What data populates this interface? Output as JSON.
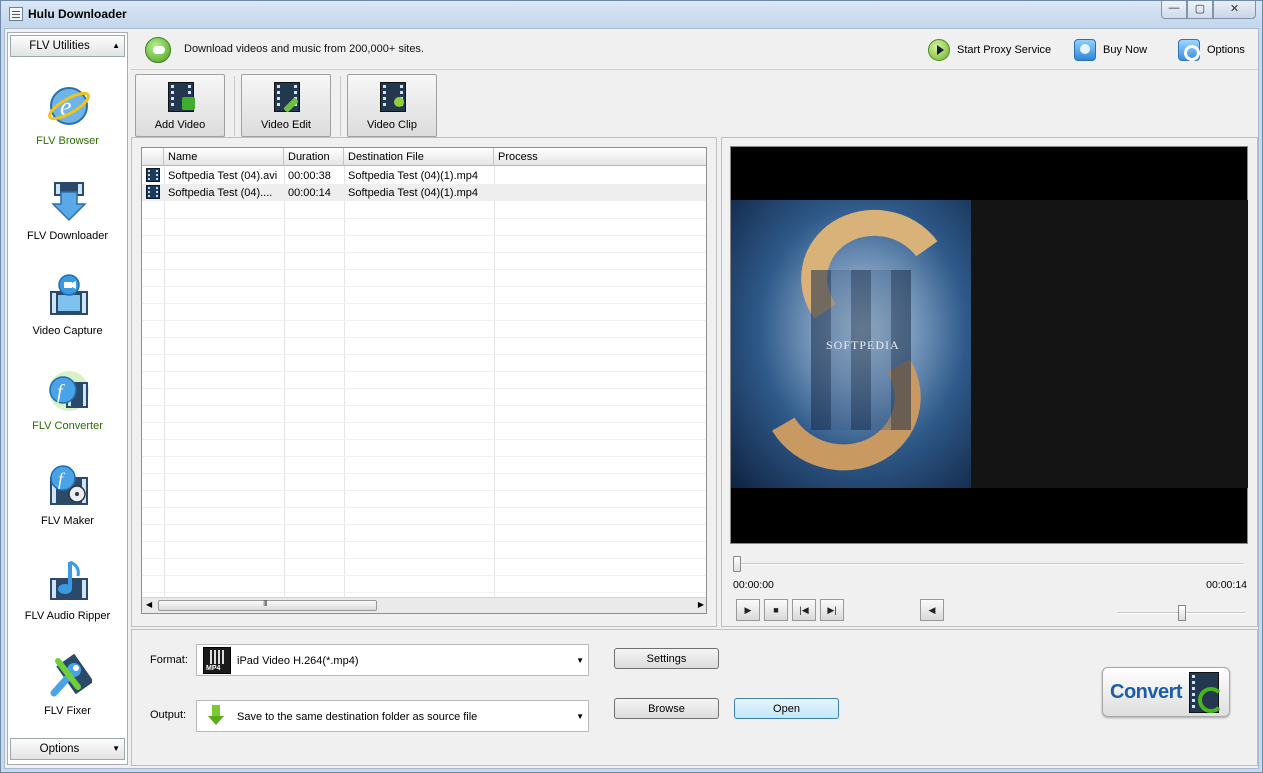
{
  "window": {
    "title": "Hulu Downloader",
    "minimize_glyph": "—",
    "maximize_glyph": "▢",
    "close_glyph": "✕"
  },
  "sidebar": {
    "header_label": "FLV Utilities",
    "footer_label": "Options",
    "items": [
      {
        "label": "FLV Browser",
        "icon": "globe-e-icon",
        "active": true
      },
      {
        "label": "FLV Downloader",
        "icon": "download-arrow-icon",
        "active": false
      },
      {
        "label": "Video Capture",
        "icon": "video-camera-icon",
        "active": false
      },
      {
        "label": "FLV Converter",
        "icon": "converter-f-icon",
        "active": true
      },
      {
        "label": "FLV Maker",
        "icon": "maker-f-film-icon",
        "active": false
      },
      {
        "label": "FLV Audio Ripper",
        "icon": "music-note-icon",
        "active": false
      },
      {
        "label": "FLV Fixer",
        "icon": "wrench-icon",
        "active": false
      }
    ]
  },
  "topbar": {
    "tagline": "Download videos and music from 200,000+ sites.",
    "links": [
      {
        "label": "Start Proxy Service",
        "icon": "play-circle-icon"
      },
      {
        "label": "Buy Now",
        "icon": "buy-icon"
      },
      {
        "label": "Options",
        "icon": "gears-icon"
      }
    ]
  },
  "toolbar": {
    "buttons": [
      {
        "label": "Add Video",
        "icon": "add-video-icon",
        "badge_color": "#3fae2a"
      },
      {
        "label": "Video Edit",
        "icon": "edit-video-icon",
        "badge_color": "#6bc23a"
      },
      {
        "label": "Video Clip",
        "icon": "clip-video-icon",
        "badge_color": "#8fcf3a"
      }
    ]
  },
  "file_list": {
    "columns": [
      "Name",
      "Duration",
      "Destination File",
      "Process"
    ],
    "rows": [
      {
        "name": "Softpedia Test (04).avi",
        "duration": "00:00:38",
        "destination": "Softpedia Test (04)(1).mp4",
        "process": ""
      },
      {
        "name": "Softpedia Test (04)....",
        "duration": "00:00:14",
        "destination": "Softpedia Test (04)(1).mp4",
        "process": ""
      }
    ],
    "scroll_grip": "III"
  },
  "preview": {
    "watermark": "SOFTPEDIA",
    "time_current": "00:00:00",
    "time_total": "00:00:14",
    "seek_position": 0,
    "volume_level": 0.5,
    "controls": [
      {
        "name": "play-button",
        "glyph": "▶"
      },
      {
        "name": "stop-button",
        "glyph": "■"
      },
      {
        "name": "prev-button",
        "glyph": "|◀"
      },
      {
        "name": "next-button",
        "glyph": "▶|"
      }
    ],
    "mute_glyph": "◀"
  },
  "output_settings": {
    "format_label": "Format:",
    "format_value": "iPad Video H.264(*.mp4)",
    "format_badge": "MP4",
    "output_label": "Output:",
    "output_value": "Save to the same destination folder as source file",
    "settings_button": "Settings",
    "browse_button": "Browse",
    "open_button": "Open",
    "convert_button": "Convert"
  },
  "colors": {
    "active_sidebar_label": "#2a6e00",
    "convert_text": "#1d5ea8",
    "open_button_hover": "#c3e7f9"
  }
}
